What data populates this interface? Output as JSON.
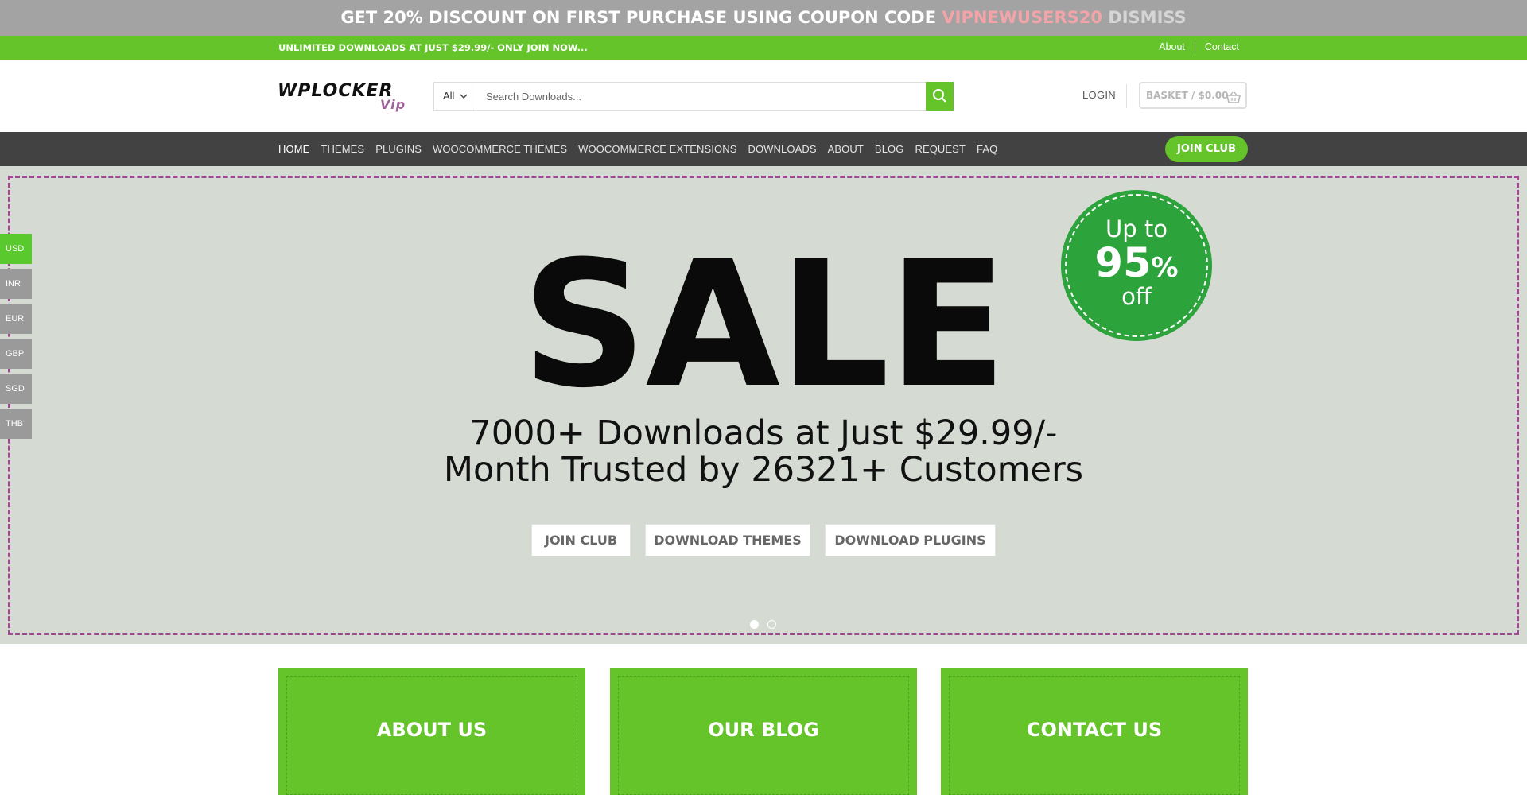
{
  "promo": {
    "text": "GET 20% DISCOUNT ON FIRST PURCHASE USING COUPON CODE",
    "code": "VIPNEWUSERS20",
    "dismiss": "DISMISS"
  },
  "topbar": {
    "message": "UNLIMITED DOWNLOADS AT JUST $29.99/- ONLY JOIN NOW...",
    "links": [
      "About",
      "Contact"
    ]
  },
  "header": {
    "logo_main": "WPLOCKER",
    "logo_sub": "Vip",
    "search": {
      "category": "All",
      "placeholder": "Search Downloads..."
    },
    "login": "LOGIN",
    "basket": "BASKET / $0.00"
  },
  "nav": {
    "items": [
      "HOME",
      "THEMES",
      "PLUGINS",
      "WOOCOMMERCE THEMES",
      "WOOCOMMERCE EXTENSIONS",
      "DOWNLOADS",
      "ABOUT",
      "BLOG",
      "REQUEST",
      "FAQ"
    ],
    "active": "HOME",
    "join": "JOIN CLUB"
  },
  "hero": {
    "title": "SALE",
    "subtitle_line1": "7000+ Downloads at Just $29.99/-",
    "subtitle_line2": "Month Trusted by 26321+ Customers",
    "badge": {
      "top": "Up to",
      "value": "95",
      "unit": "%",
      "bottom": "off"
    },
    "buttons": [
      "JOIN CLUB",
      "DOWNLOAD THEMES",
      "DOWNLOAD PLUGINS"
    ],
    "slides": {
      "count": 2,
      "current": 1
    }
  },
  "currencies": {
    "items": [
      "USD",
      "INR",
      "EUR",
      "GBP",
      "SGD",
      "THB"
    ],
    "selected": "USD"
  },
  "cards": [
    "ABOUT US",
    "OUR BLOG",
    "CONTACT US"
  ],
  "colors": {
    "green": "#64c42a",
    "nav": "#424242",
    "hero_bg": "#d5dad3",
    "badge": "#2ca33b",
    "coupon": "#f4a3a8",
    "frame": "#9b4a8d"
  }
}
